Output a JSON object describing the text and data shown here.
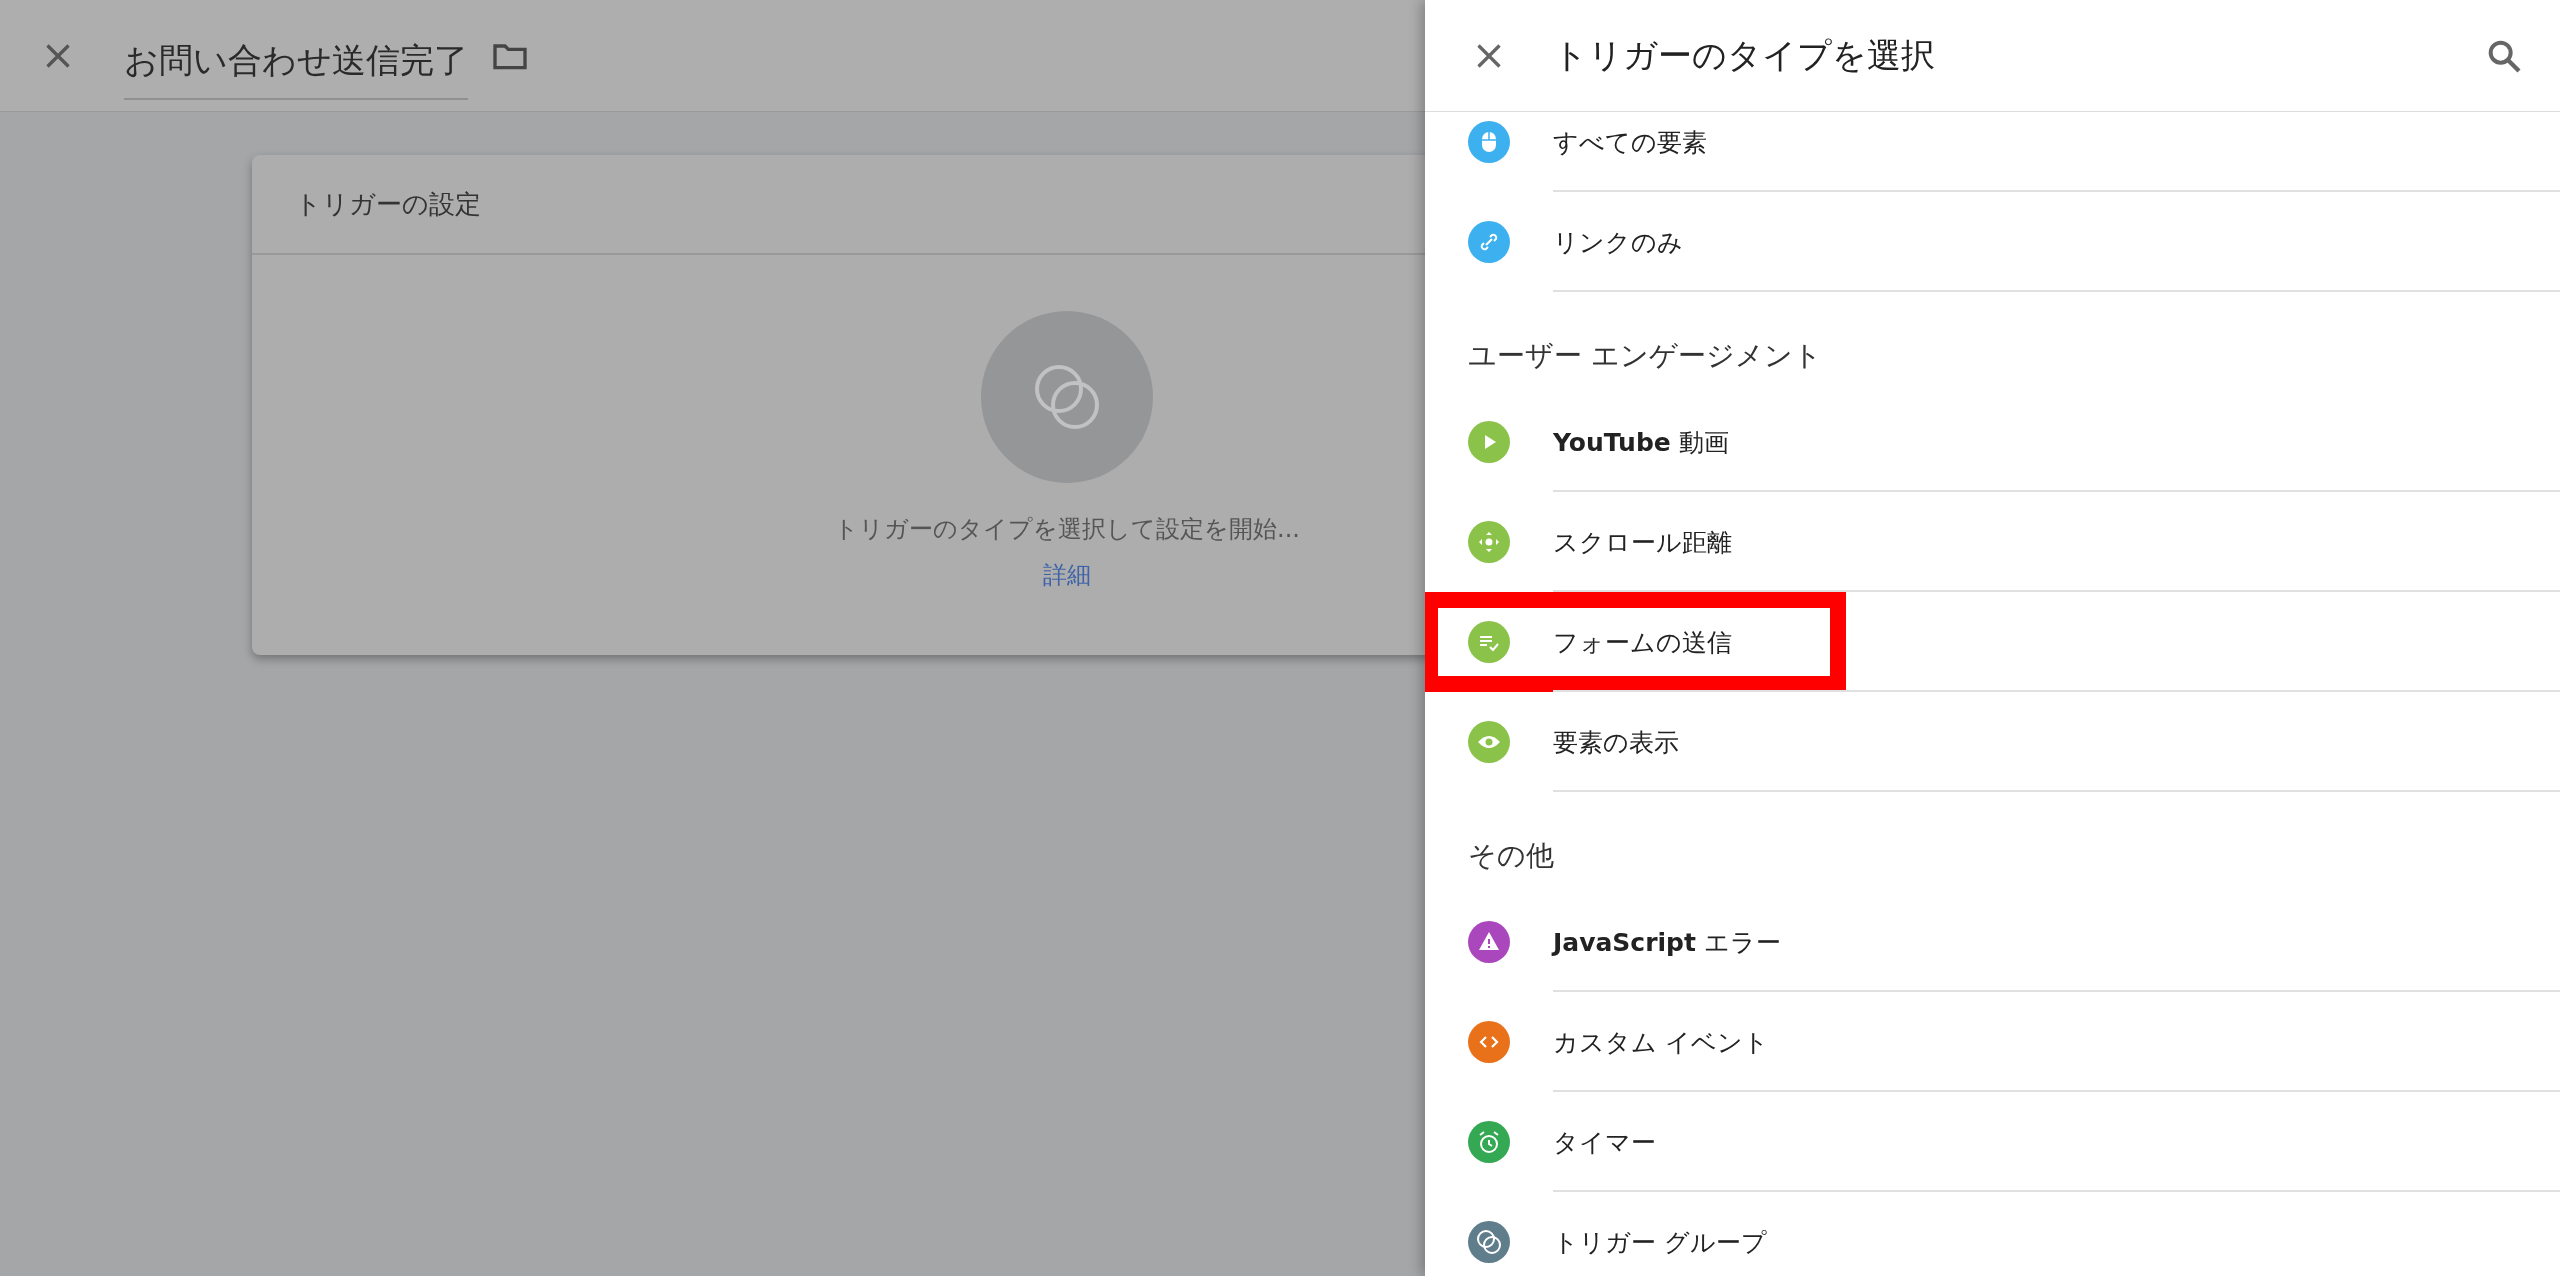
{
  "editor": {
    "title": "お問い合わせ送信完了",
    "card": {
      "title": "トリガーの設定",
      "prompt": "トリガーのタイプを選択して設定を開始...",
      "link": "詳細"
    }
  },
  "panel": {
    "title": "トリガーのタイプを選択",
    "sections": [
      {
        "items": [
          {
            "label": "すべての要素",
            "kind": "mouse",
            "color": "#3db0ef",
            "highlighted": false
          },
          {
            "label": "リンクのみ",
            "kind": "link",
            "color": "#3db0ef",
            "highlighted": false
          }
        ]
      },
      {
        "heading": "ユーザー エンゲージメント",
        "items": [
          {
            "label": "**YouTube** 動画",
            "kind": "play",
            "color": "#8bc34a",
            "highlighted": false
          },
          {
            "label": "スクロール距離",
            "kind": "scroll",
            "color": "#8bc34a",
            "highlighted": false
          },
          {
            "label": "フォームの送信",
            "kind": "form",
            "color": "#8bc34a",
            "highlighted": true
          },
          {
            "label": "要素の表示",
            "kind": "eye",
            "color": "#8bc34a",
            "highlighted": false
          }
        ]
      },
      {
        "heading": "その他",
        "items": [
          {
            "label": "**JavaScript** エラー",
            "kind": "warning",
            "color": "#ab47bc",
            "highlighted": false
          },
          {
            "label": "カスタム イベント",
            "kind": "code",
            "color": "#e8711a",
            "highlighted": false
          },
          {
            "label": "タイマー",
            "kind": "timer",
            "color": "#34a853",
            "highlighted": false
          },
          {
            "label": "トリガー グループ",
            "kind": "group",
            "color": "#607d8b",
            "highlighted": false
          }
        ]
      }
    ]
  }
}
